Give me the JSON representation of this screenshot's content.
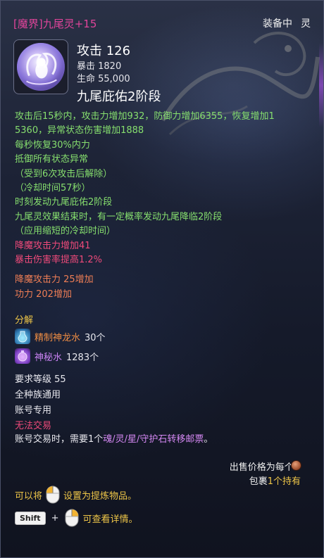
{
  "header": {
    "title": "[魔界]九尾灵+15",
    "status": "装备中",
    "type": "灵"
  },
  "item": {
    "icon": "nine-tailed-fox-orb-icon",
    "main_stat": "攻击 126",
    "sub_stats": [
      "暴击 1820",
      "生命 55,000"
    ],
    "stage": "九尾庇佑2阶段"
  },
  "effects": {
    "green": [
      "攻击后15秒内，攻击力增加932，防御力增加6355，恢复增加1",
      "5360，异常状态伤害增加1888",
      "每秒恢复30%内力",
      "抵御所有状态异常",
      "（受到6次攻击后解除）",
      "（冷却时间57秒）",
      "时刻发动九尾庇佑2阶段",
      "九尾灵效果结束时，有一定概率发动九尾降临2阶段",
      "（应用缩短的冷却时间）"
    ],
    "red": [
      "降魔攻击力增加41",
      "暴击伤害率提高1.2%"
    ],
    "orange": [
      "降魔攻击力 25增加",
      "功力 202增加"
    ]
  },
  "decompose": {
    "title": "分解",
    "materials": [
      {
        "name": "精制神龙水",
        "count": "30个",
        "icon": "refined-dragon-water-icon"
      },
      {
        "name": "神秘水",
        "count": "1283个",
        "icon": "mystic-water-icon"
      }
    ]
  },
  "requirements": {
    "level": "要求等级 55",
    "race": "全种族通用",
    "binding": "账号专用",
    "trade": "无法交易",
    "account_trade_prefix": "账号交易时，需要1个",
    "account_trade_item": "魂/灵/星/守护石转移邮票",
    "account_trade_suffix": "。"
  },
  "sell": {
    "label": "出售价格为每个3",
    "coin_icon": "copper-coin-icon"
  },
  "bag": {
    "prefix": "包裹",
    "count": "1个持有"
  },
  "hints": {
    "refine_prefix": "可以将",
    "refine_suffix": "设置为提炼物品。",
    "shift_key": "Shift",
    "plus": "+",
    "detail_suffix": "可查看详情。"
  },
  "colors": {
    "title_pink": "#e0449a",
    "effect_green": "#86df6e",
    "effect_red": "#ef4a7a",
    "effect_orange": "#ef7e55",
    "gold": "#efc648",
    "purple": "#d488f2"
  }
}
